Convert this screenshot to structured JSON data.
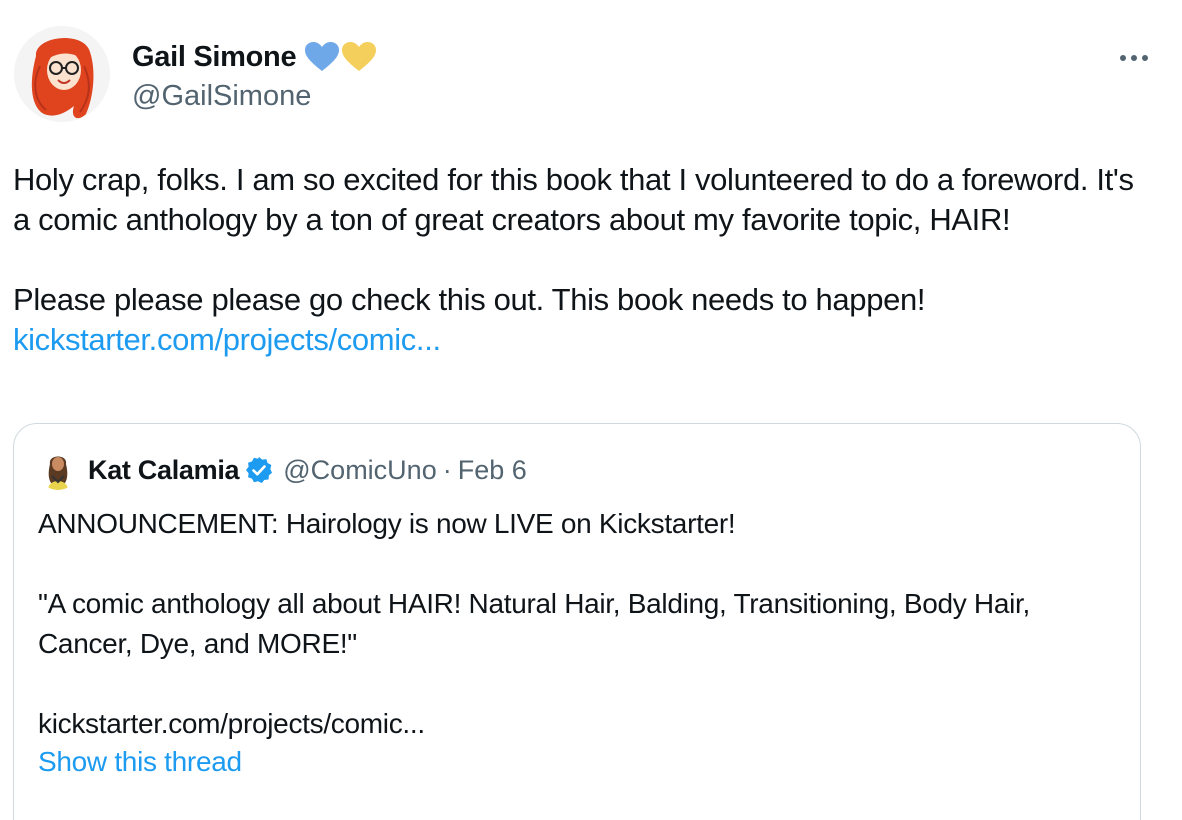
{
  "author": {
    "display_name": "Gail Simone",
    "handle": "@GailSimone",
    "badges": [
      "blue-heart-icon",
      "yellow-heart-icon"
    ]
  },
  "more_icon": "more-horizontal-icon",
  "tweet": {
    "paragraph_1": "Holy crap, folks. I am so excited for this book that I volunteered to do a foreword. It's a comic anthology by a ton of great creators about my favorite topic, HAIR!",
    "paragraph_2": "Please please please go check this out.  This book needs to happen!",
    "link": "kickstarter.com/projects/comic..."
  },
  "quoted_tweet": {
    "display_name": "Kat Calamia",
    "handle": "@ComicUno",
    "separator": "·",
    "date": "Feb 6",
    "verified_icon": "verified-badge-icon",
    "line_1": "ANNOUNCEMENT: Hairology is now LIVE on Kickstarter!",
    "line_2": "\"A comic anthology all about HAIR! Natural Hair, Balding, Transitioning, Body Hair, Cancer, Dye, and MORE!\"",
    "line_3": "kickstarter.com/projects/comic...",
    "show_thread": "Show this thread"
  },
  "colors": {
    "link": "#1d9bf0",
    "secondary_text": "#536471",
    "border": "#cfd9de",
    "blue_heart": "#6ea8e8",
    "yellow_heart": "#f5cf5b"
  }
}
